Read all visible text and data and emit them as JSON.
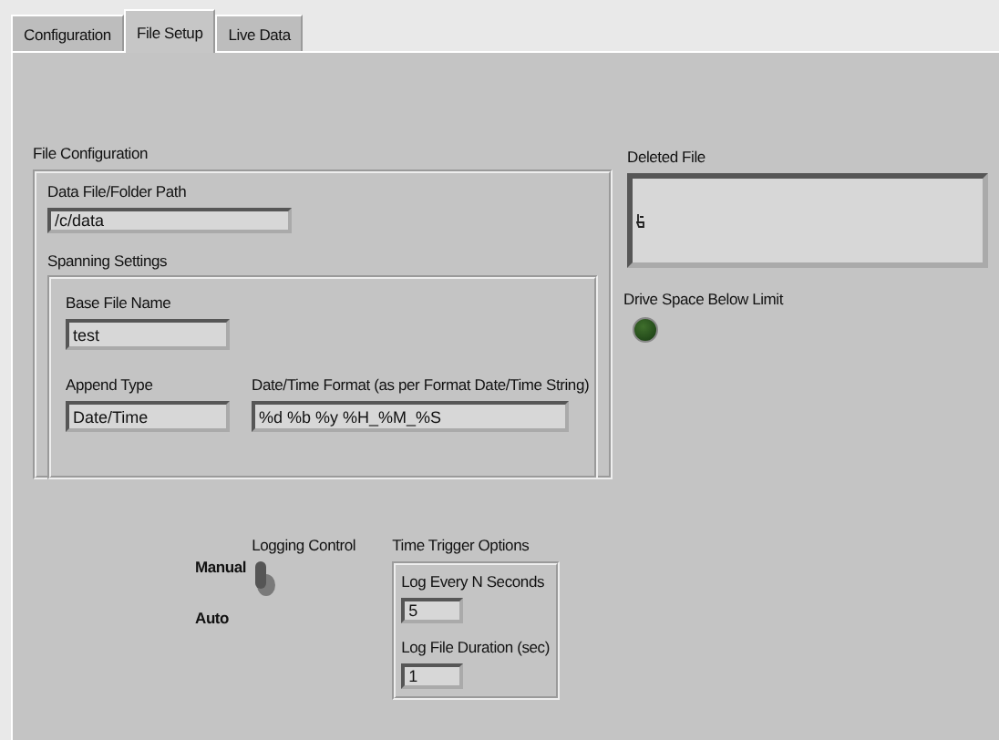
{
  "tabs": [
    {
      "label": "Configuration",
      "selected": false
    },
    {
      "label": "File Setup",
      "selected": true
    },
    {
      "label": "Live Data",
      "selected": false
    }
  ],
  "file_configuration": {
    "label": "File Configuration",
    "data_path": {
      "label": "Data File/Folder Path",
      "value": "/c/data"
    },
    "spanning_settings": {
      "label": "Spanning Settings",
      "base_file_name": {
        "label": "Base File Name",
        "value": "test"
      },
      "append_type": {
        "label": "Append Type",
        "value": "Date/Time"
      },
      "date_time_format": {
        "label": "Date/Time Format (as per Format Date/Time String)",
        "value": "%d %b %y %H_%M_%S"
      }
    }
  },
  "deleted_file": {
    "label": "Deleted File"
  },
  "drive_space_below_limit": {
    "label": "Drive Space Below Limit",
    "on": false
  },
  "logging_control": {
    "label": "Logging Control",
    "top_label": "Manual",
    "bottom_label": "Auto",
    "up": true
  },
  "time_trigger_options": {
    "label": "Time Trigger Options",
    "fields": [
      {
        "label": "Log Every N Seconds",
        "value": "5"
      },
      {
        "label": "Log File Duration (sec)",
        "value": "1"
      }
    ]
  }
}
